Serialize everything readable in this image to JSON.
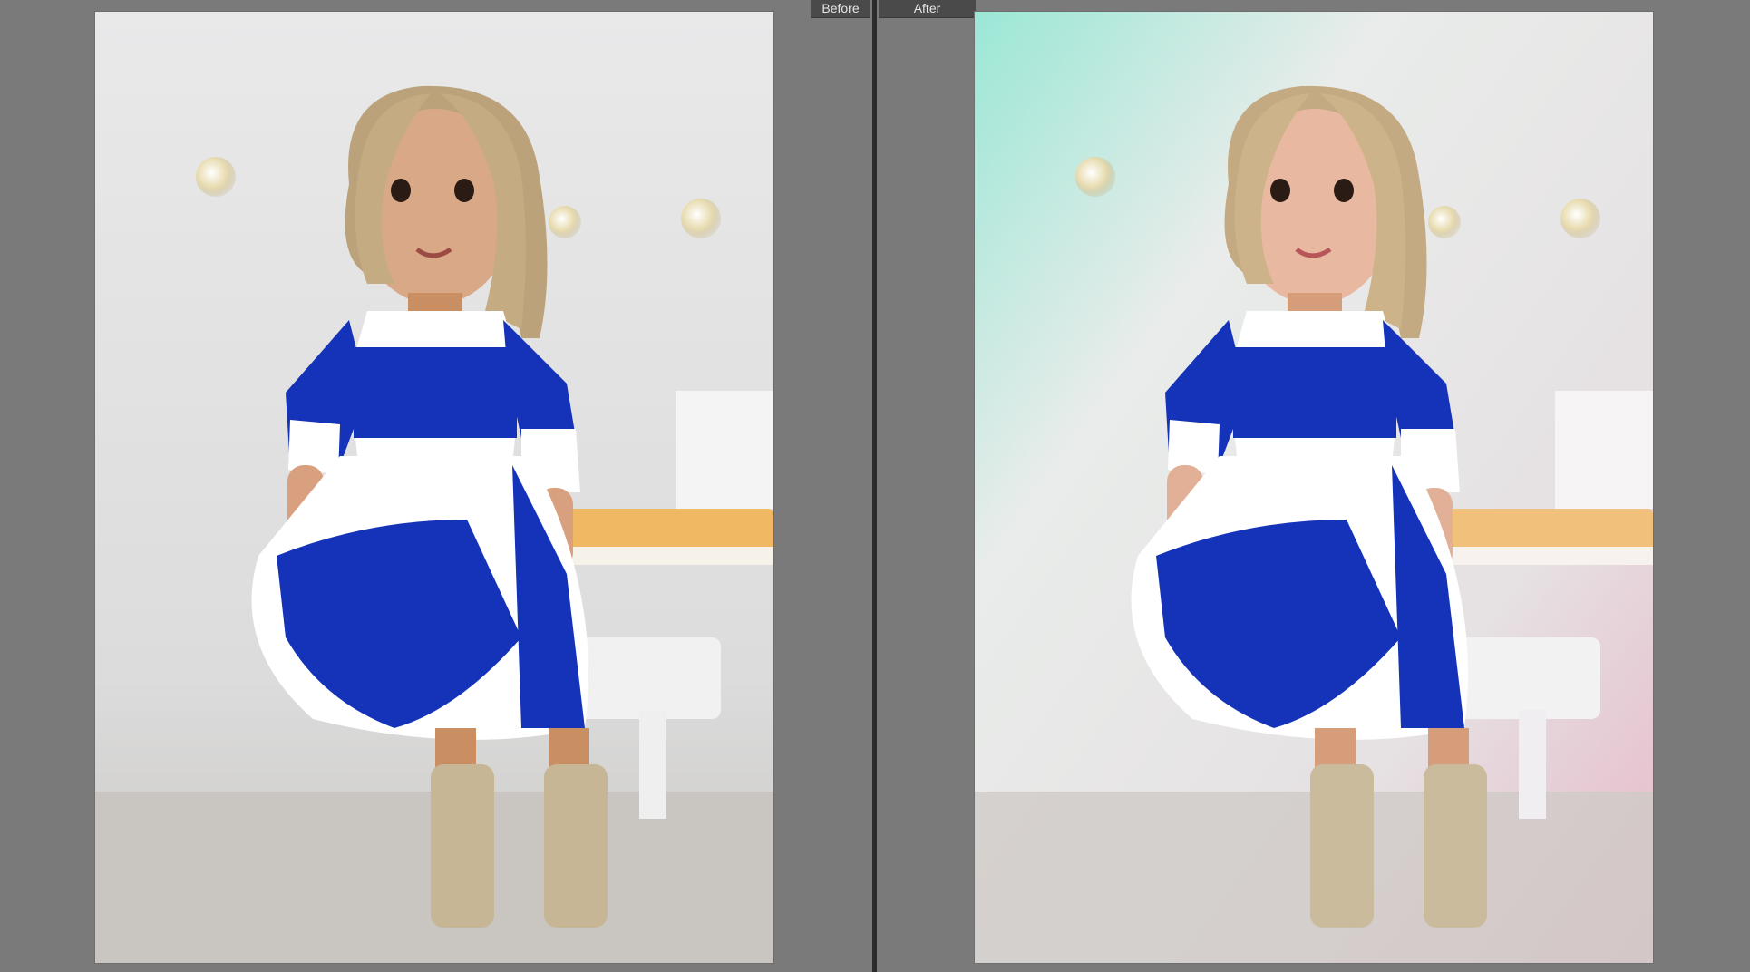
{
  "compare": {
    "before_label": "Before",
    "after_label": "After"
  },
  "colors": {
    "background": "#7a7a7a",
    "divider": "#2b2b2b",
    "tab_bg": "#4a4a4a",
    "dress_blue": "#1533b8",
    "after_tint_left": "#a8f0dc",
    "after_tint_right": "#e8b8c8"
  }
}
